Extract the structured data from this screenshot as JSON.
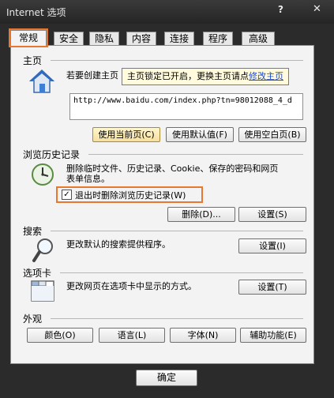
{
  "window": {
    "title": "Internet 选项",
    "help_glyph": "?",
    "close_glyph": "✕"
  },
  "tabs": [
    {
      "label": "常规",
      "active": true
    },
    {
      "label": "安全"
    },
    {
      "label": "隐私"
    },
    {
      "label": "内容"
    },
    {
      "label": "连接"
    },
    {
      "label": "程序"
    },
    {
      "label": "高级"
    }
  ],
  "homepage": {
    "section": "主页",
    "instruction": "若要创建主页",
    "url": "http://www.baidu.com/index.php?tn=98012088_4_d",
    "tooltip_text": "主页锁定已开启，更换主页请点",
    "tooltip_link": "修改主页",
    "buttons": {
      "use_current": "使用当前页(C)",
      "use_default": "使用默认值(F)",
      "use_blank": "使用空白页(B)"
    }
  },
  "history": {
    "section": "浏览历史记录",
    "description_line1": "删除临时文件、历史记录、Cookie、保存的密码和网页",
    "description_line2": "表单信息。",
    "checkbox_label": "退出时删除浏览历史记录(W)",
    "checkbox_checked": true,
    "delete_button": "删除(D)...",
    "settings_button": "设置(S)"
  },
  "search": {
    "section": "搜索",
    "description": "更改默认的搜索提供程序。",
    "settings_button": "设置(I)"
  },
  "tabbed": {
    "section": "选项卡",
    "description": "更改网页在选项卡中显示的方式。",
    "settings_button": "设置(T)"
  },
  "appearance": {
    "section": "外观",
    "buttons": {
      "colors": "颜色(O)",
      "languages": "语言(L)",
      "fonts": "字体(N)",
      "accessibility": "辅助功能(E)"
    }
  },
  "footer": {
    "ok": "确定"
  },
  "colors": {
    "highlight_outline": "#e8782f",
    "link": "#1d49c7",
    "tooltip_bg": "#fffbdc"
  },
  "icons": [
    "home-icon",
    "history-clock-icon",
    "search-magnifier-icon",
    "tabs-window-icon",
    "checkmark-icon",
    "close-icon"
  ]
}
